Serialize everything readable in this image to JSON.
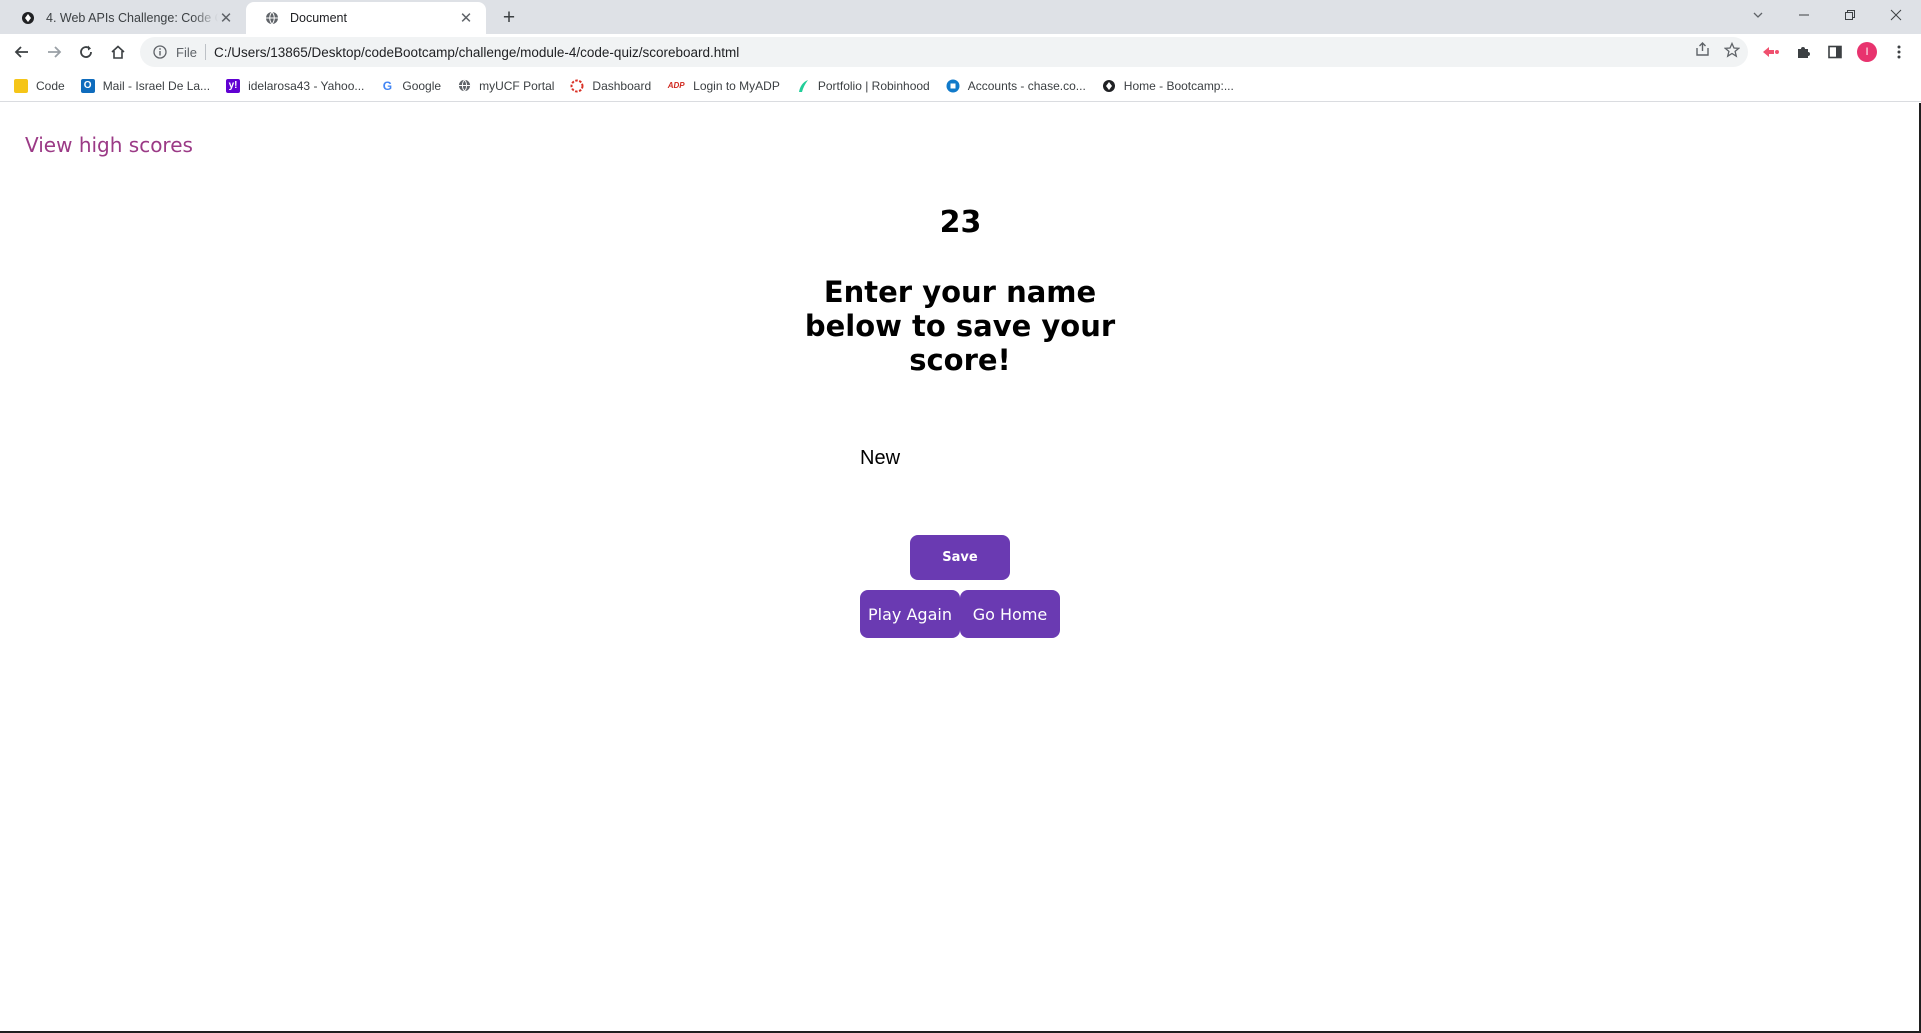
{
  "browser": {
    "tabs": [
      {
        "title": "4. Web APIs Challenge: Code Quiz",
        "icon": "bootcamp-icon",
        "active": false
      },
      {
        "title": "Document",
        "icon": "globe-icon",
        "active": true
      }
    ],
    "new_tab_symbol": "+",
    "address_bar": {
      "scheme_label": "File",
      "url": "C:/Users/13865/Desktop/codeBootcamp/challenge/module-4/code-quiz/scoreboard.html"
    },
    "profile_initial": "I",
    "bookmarks": [
      {
        "label": "Code",
        "icon": "folder-icon",
        "color": "#f5c518"
      },
      {
        "label": "Mail - Israel De La...",
        "icon": "outlook-icon",
        "color": "#0f6cbd"
      },
      {
        "label": "idelarosa43 - Yahoo...",
        "icon": "yahoo-icon",
        "color": "#6001d2"
      },
      {
        "label": "Google",
        "icon": "google-icon",
        "color": "#4285f4"
      },
      {
        "label": "myUCF Portal",
        "icon": "globe-icon",
        "color": "#5f6368"
      },
      {
        "label": "Dashboard",
        "icon": "dashboard-icon",
        "color": "#d93025"
      },
      {
        "label": "Login to MyADP",
        "icon": "adp-icon",
        "color": "#d0271d"
      },
      {
        "label": "Portfolio | Robinhood",
        "icon": "robinhood-icon",
        "color": "#21ce99"
      },
      {
        "label": "Accounts - chase.co...",
        "icon": "chase-icon",
        "color": "#117aca"
      },
      {
        "label": "Home - Bootcamp:...",
        "icon": "bootcamp-icon",
        "color": "#202124"
      }
    ]
  },
  "page": {
    "high_scores_link": "View high scores",
    "score": "23",
    "prompt": "Enter your name below to save your score!",
    "name_input_value": "New",
    "buttons": {
      "save": "Save",
      "play_again": "Play Again",
      "go_home": "Go Home"
    },
    "colors": {
      "accent": "#6a3ab2",
      "link": "#9b3a86"
    }
  }
}
